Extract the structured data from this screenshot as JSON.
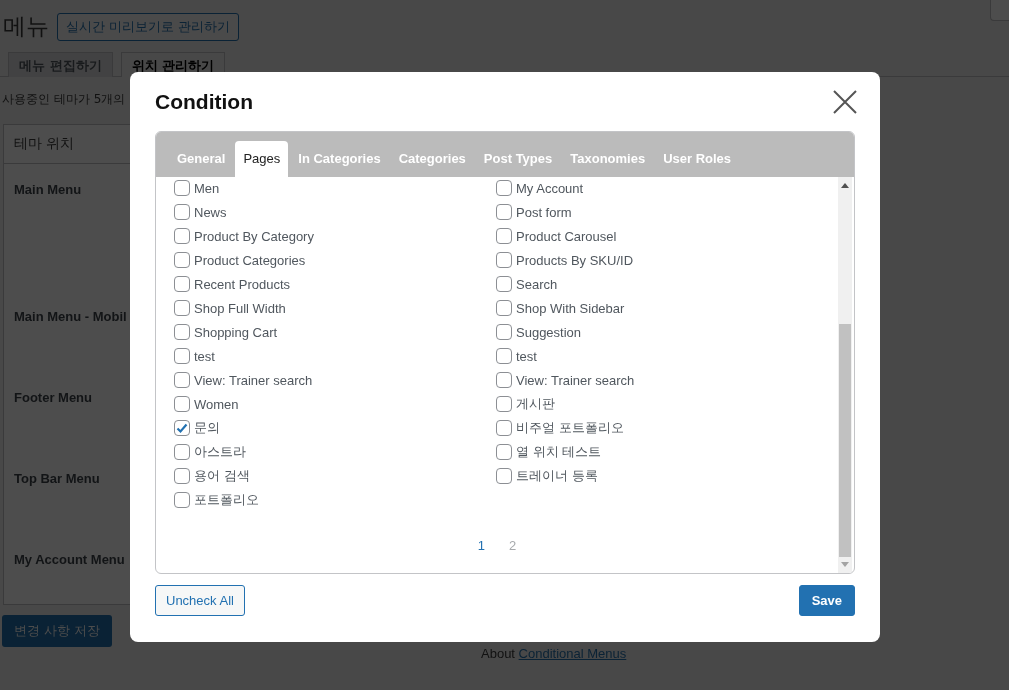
{
  "page": {
    "title": "메뉴",
    "live_button": "실시간 미리보기로 관리하기",
    "tabs": [
      {
        "label": "메뉴 편집하기",
        "selected": false
      },
      {
        "label": "위치 관리하기",
        "selected": true
      }
    ],
    "notice": "사용중인 테마가 5개의",
    "table": {
      "header": "테마 위치",
      "rows": [
        "Main Menu",
        "Main Menu - Mobil",
        "Footer Menu",
        "Top Bar Menu",
        "My Account Menu"
      ]
    },
    "save_button": "변경 사항 저장",
    "footer": {
      "text": "About",
      "link": "Conditional Menus"
    }
  },
  "dialog": {
    "title": "Condition",
    "tabs": [
      {
        "label": "General",
        "selected": false
      },
      {
        "label": "Pages",
        "selected": true
      },
      {
        "label": "In Categories",
        "selected": false
      },
      {
        "label": "Categories",
        "selected": false
      },
      {
        "label": "Post Types",
        "selected": false
      },
      {
        "label": "Taxonomies",
        "selected": false
      },
      {
        "label": "User Roles",
        "selected": false
      }
    ],
    "columns": [
      [
        {
          "label": "Men",
          "checked": false
        },
        {
          "label": "News",
          "checked": false
        },
        {
          "label": "Product By Category",
          "checked": false
        },
        {
          "label": "Product Categories",
          "checked": false
        },
        {
          "label": "Recent Products",
          "checked": false
        },
        {
          "label": "Shop Full Width",
          "checked": false
        },
        {
          "label": "Shopping Cart",
          "checked": false
        },
        {
          "label": "test",
          "checked": false
        },
        {
          "label": "View: Trainer search",
          "checked": false
        },
        {
          "label": "Women",
          "checked": false
        },
        {
          "label": "문의",
          "checked": true
        },
        {
          "label": "아스트라",
          "checked": false
        },
        {
          "label": "용어 검색",
          "checked": false
        },
        {
          "label": "포트폴리오",
          "checked": false
        }
      ],
      [
        {
          "label": "My Account",
          "checked": false
        },
        {
          "label": "Post form",
          "checked": false
        },
        {
          "label": "Product Carousel",
          "checked": false
        },
        {
          "label": "Products By SKU/ID",
          "checked": false
        },
        {
          "label": "Search",
          "checked": false
        },
        {
          "label": "Shop With Sidebar",
          "checked": false
        },
        {
          "label": "Suggestion",
          "checked": false
        },
        {
          "label": "test",
          "checked": false
        },
        {
          "label": "View: Trainer search",
          "checked": false
        },
        {
          "label": "게시판",
          "checked": false
        },
        {
          "label": "비주얼 포트폴리오",
          "checked": false
        },
        {
          "label": "열 위치 테스트",
          "checked": false
        },
        {
          "label": "트레이너 등록",
          "checked": false
        }
      ]
    ],
    "pagination": [
      {
        "label": "1",
        "selected": true
      },
      {
        "label": "2",
        "selected": false
      }
    ],
    "uncheck_button": "Uncheck All",
    "save_button": "Save"
  }
}
